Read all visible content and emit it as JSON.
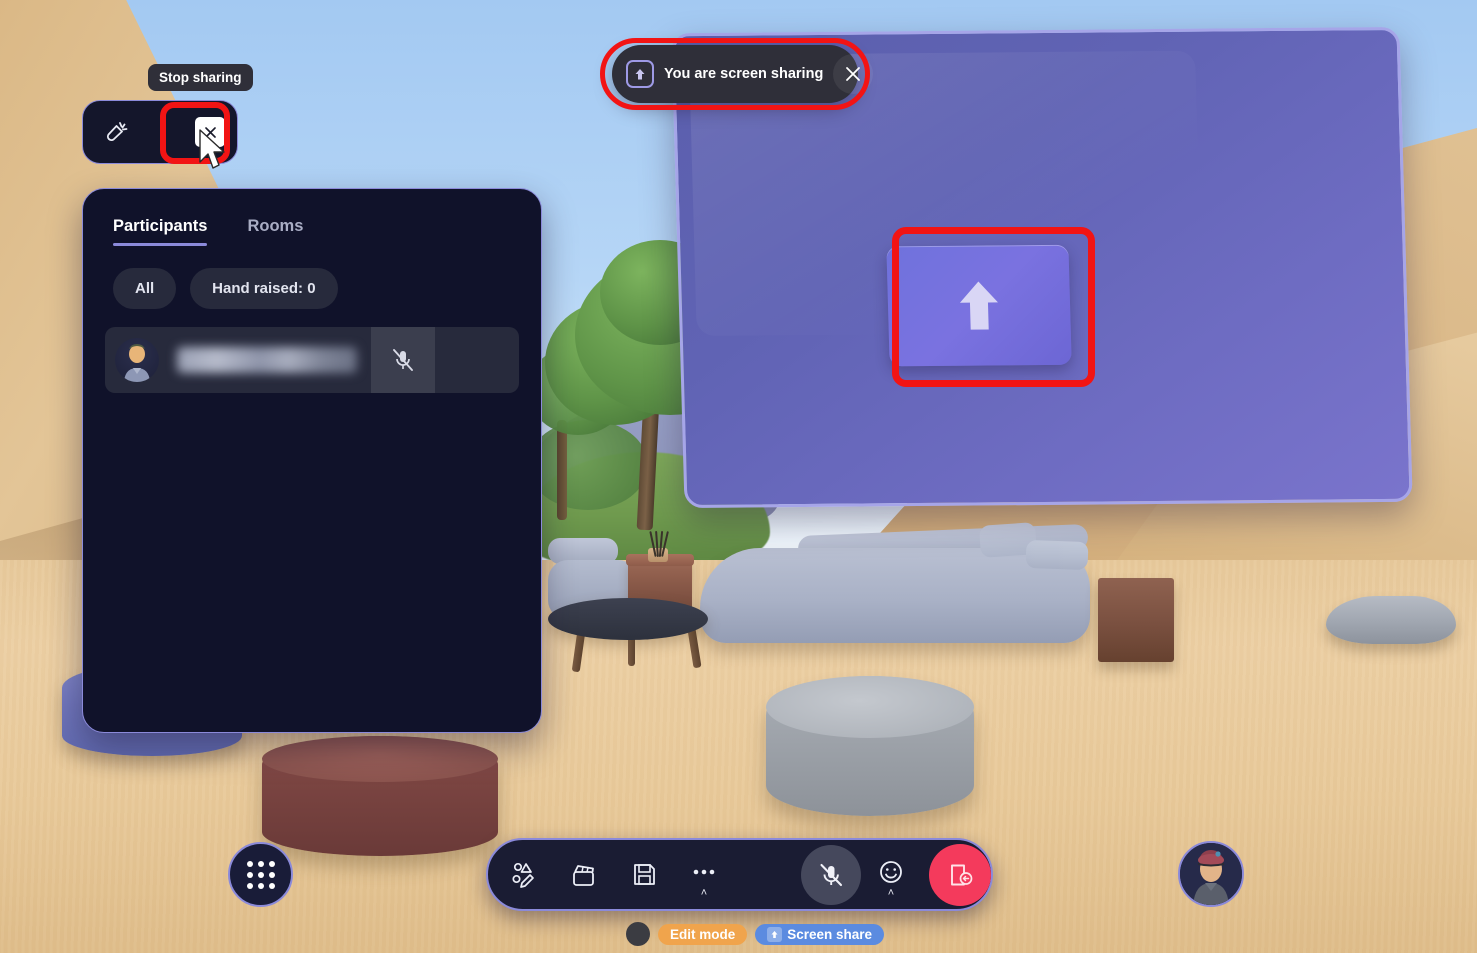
{
  "app": {
    "environment_name": "virtual-meeting-space"
  },
  "banner": {
    "icon": "share-screen-icon",
    "text": "You are screen sharing",
    "close_icon": "close-icon"
  },
  "tooltip": {
    "text": "Stop sharing"
  },
  "mini_toolbar": {
    "buttons": [
      {
        "icon": "megaphone-icon",
        "label": ""
      },
      {
        "icon": "close-icon",
        "label": ""
      }
    ]
  },
  "panel": {
    "tabs": [
      {
        "label": "Participants",
        "active": true
      },
      {
        "label": "Rooms",
        "active": false
      }
    ],
    "filters": [
      {
        "label": "All"
      },
      {
        "label": "Hand raised: 0"
      }
    ],
    "participants": [
      {
        "name": "",
        "name_hidden": true,
        "mic_icon": "microphone-muted-icon"
      }
    ]
  },
  "display": {
    "placeholder_icon": "upload-arrow-icon"
  },
  "bottom_toolbar": {
    "buttons": [
      {
        "icon": "build-mode-icon",
        "label": ""
      },
      {
        "icon": "clapperboard-icon",
        "label": ""
      },
      {
        "icon": "save-icon",
        "label": ""
      },
      {
        "icon": "more-icon",
        "label": "",
        "caret": "˄"
      },
      {
        "icon": "microphone-muted-icon",
        "label": "",
        "state": "muted"
      },
      {
        "icon": "emoji-icon",
        "label": "",
        "caret": "˄"
      },
      {
        "icon": "leave-room-icon",
        "label": "",
        "state": "leave"
      }
    ]
  },
  "grid_button": {
    "icon": "apps-grid-icon"
  },
  "avatar_button": {
    "icon": "user-avatar-icon"
  },
  "status_bar": {
    "badges": [
      {
        "label": "Edit mode",
        "color": "#f0a44c",
        "icon": ""
      },
      {
        "label": "Screen share",
        "color": "#5b8be0",
        "icon": "share-screen-icon"
      }
    ]
  },
  "colors": {
    "accent_purple": "#8b8ada",
    "panel_bg": "#10122a",
    "annotation_red": "#f21414",
    "leave_red": "#f43a5c",
    "edit_mode_orange": "#f0a44c",
    "screen_share_blue": "#5b8be0"
  }
}
